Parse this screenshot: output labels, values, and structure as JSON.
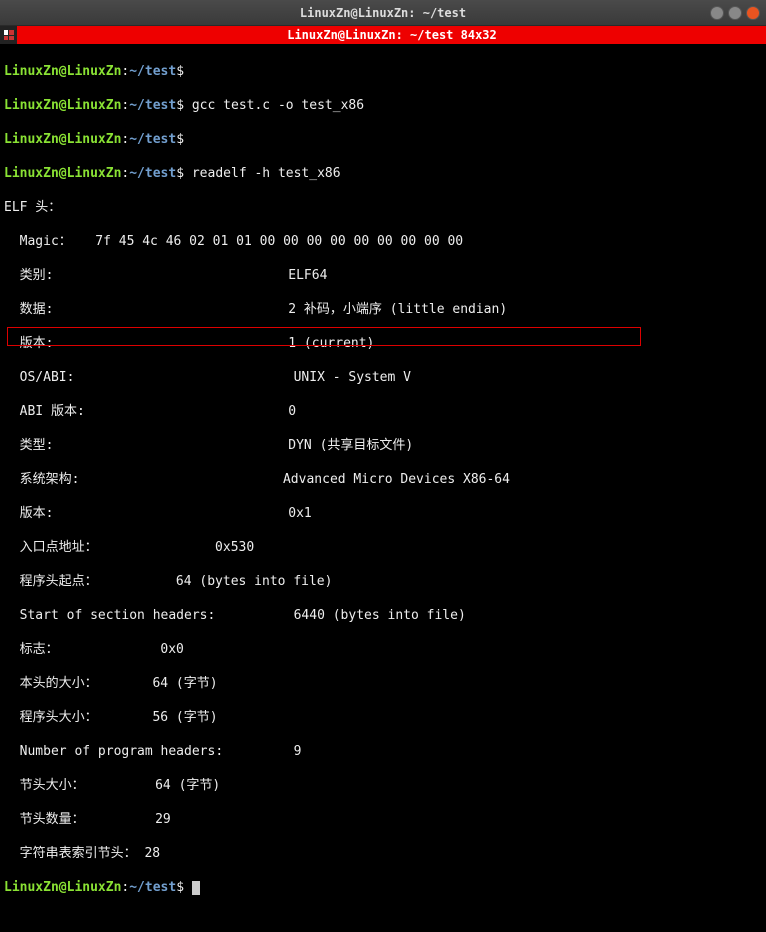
{
  "window": {
    "title": "LinuxZn@LinuxZn: ~/test"
  },
  "tab": {
    "title": "LinuxZn@LinuxZn: ~/test 84x32"
  },
  "prompt": {
    "user": "LinuxZn@LinuxZn",
    "sep": ":",
    "path": "~/test",
    "symbol": "$"
  },
  "lines": {
    "cmd1": "",
    "cmd2": "gcc test.c -o test_x86",
    "cmd3": "",
    "cmd4": "readelf -h test_x86",
    "o0": "ELF 头：",
    "o1": "  Magic：   7f 45 4c 46 02 01 01 00 00 00 00 00 00 00 00 00 ",
    "o2a": "  类别:                              ",
    "o2b": "ELF64",
    "o3a": "  数据:                              ",
    "o3b": "2 补码，小端序 (little endian)",
    "o4a": "  版本:                              ",
    "o4b": "1 (current)",
    "o5a": "  OS/ABI:                            ",
    "o5b": "UNIX - System V",
    "o6a": "  ABI 版本:                          ",
    "o6b": "0",
    "o7a": "  类型:                              ",
    "o7b": "DYN (共享目标文件)",
    "o8a": "  系统架构:                          ",
    "o8b": "Advanced Micro Devices X86-64",
    "o9a": "  版本:                              ",
    "o9b": "0x1",
    "o10": "  入口点地址：               0x530",
    "o11": "  程序头起点：          64 (bytes into file)",
    "o12a": "  Start of section headers:          ",
    "o12b": "6440 (bytes into file)",
    "o13": "  标志：             0x0",
    "o14": "  本头的大小：       64 (字节)",
    "o15": "  程序头大小：       56 (字节)",
    "o16a": "  Number of program headers:         ",
    "o16b": "9",
    "o17": "  节头大小：         64 (字节)",
    "o18": "  节头数量：         29",
    "o19": "  字符串表索引节头： 28"
  },
  "highlight": {
    "top": "283",
    "left": "7",
    "width": "634",
    "height": "19"
  }
}
